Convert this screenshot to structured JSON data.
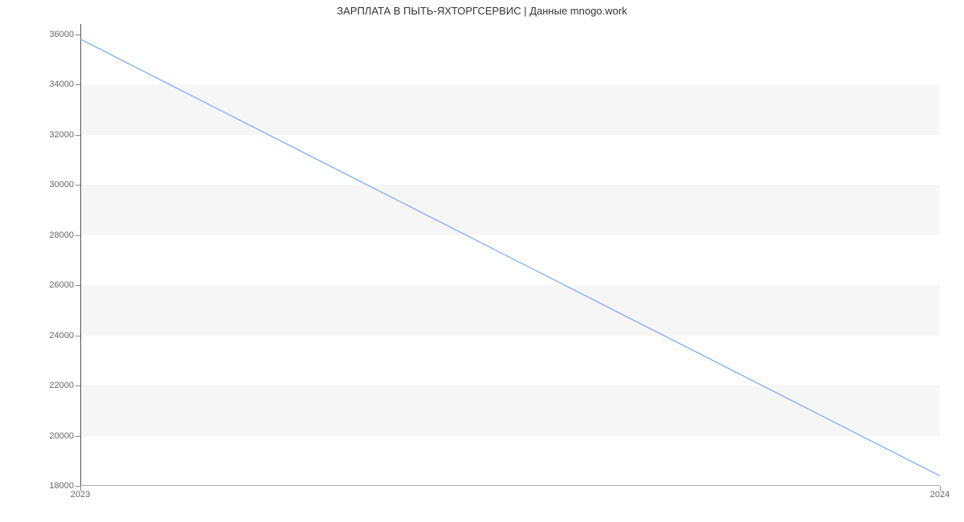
{
  "chart_data": {
    "type": "line",
    "title": "ЗАРПЛАТА В  ПЫТЬ-ЯХТОРГСЕРВИС | Данные mnogo.work",
    "xlabel": "",
    "ylabel": "",
    "x": [
      "2023",
      "2024"
    ],
    "x_numeric": [
      0,
      1
    ],
    "xlim": [
      0,
      1
    ],
    "ylim": [
      18000,
      36400
    ],
    "y_ticks": [
      18000,
      20000,
      22000,
      24000,
      26000,
      28000,
      30000,
      32000,
      34000,
      36000
    ],
    "series": [
      {
        "name": "salary",
        "values": [
          35800,
          18400
        ],
        "color": "#6fa8ff"
      }
    ],
    "bands_alternating": true
  }
}
